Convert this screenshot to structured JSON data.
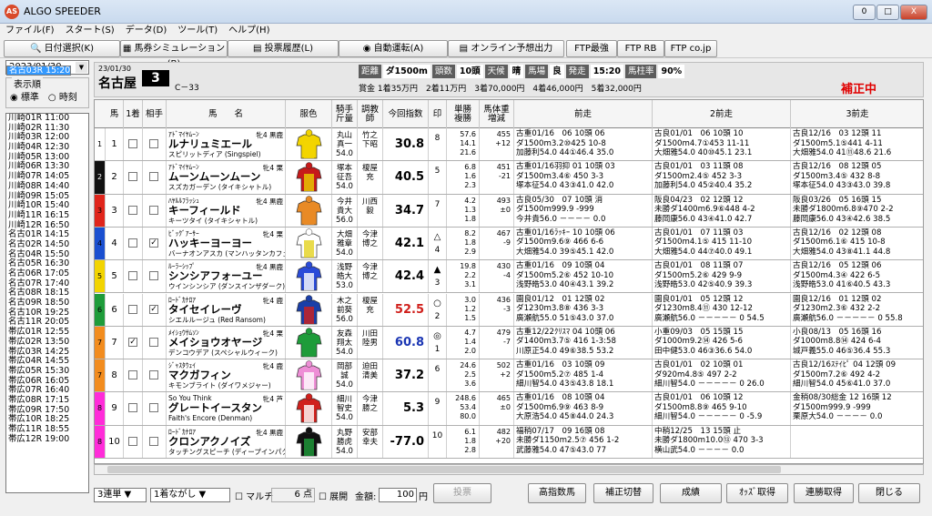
{
  "app": {
    "title": "ALGO SPEEDER",
    "logo": "AS",
    "min": "0",
    "max": "□",
    "close": "X"
  },
  "menu": [
    "ファイル(F)",
    "スタート(S)",
    "データ(D)",
    "ツール(T)",
    "ヘルプ(H)"
  ],
  "toolbar": {
    "date_select": "日付選択(K)",
    "baken_sim": "馬券シミュレーション(B)",
    "vote_history": "投票履歴(L)",
    "auto_vote": "自動運転(A)",
    "online": "オンライン予想出力",
    "ftp_best": "FTP最強",
    "ftp_rb": "FTP RB",
    "ftp_cojp": "FTP co.jp"
  },
  "left": {
    "date": "2023/01/30",
    "order_label": "表示順",
    "opt_std": "標準",
    "opt_time": "時刻",
    "races": [
      "川崎01R 11:00",
      "川崎02R 11:30",
      "川崎03R 12:00",
      "川崎04R 12:30",
      "川崎05R 13:00",
      "川崎06R 13:30",
      "川崎07R 14:05",
      "川崎08R 14:40",
      "川崎09R 15:05",
      "川崎10R 15:40",
      "川崎11R 16:15",
      "川崎12R 16:50",
      "名古01R 14:15",
      "名古02R 14:50",
      "名古03R 15:20",
      "名古04R 15:50",
      "名古05R 16:30",
      "名古06R 17:05",
      "名古07R 17:40",
      "名古08R 18:15",
      "名古09R 18:50",
      "名古10R 19:25",
      "名古11R 20:05",
      "帯広01R 12:55",
      "帯広02R 13:50",
      "帯広03R 14:25",
      "帯広04R 14:55",
      "帯広05R 15:30",
      "帯広06R 16:05",
      "帯広07R 16:40",
      "帯広08R 17:15",
      "帯広09R 17:50",
      "帯広10R 18:25",
      "帯広11R 18:55",
      "帯広12R 19:00"
    ],
    "selected": 14
  },
  "race": {
    "date": "23/01/30",
    "venue": "名古屋",
    "number": "3",
    "class": "C－33",
    "info": [
      [
        "距離",
        "ダ1500m"
      ],
      [
        "頭数",
        "10頭"
      ],
      [
        "天候",
        "晴"
      ],
      [
        "馬場",
        "良"
      ],
      [
        "発走",
        "15:20"
      ],
      [
        "馬柱率",
        "90%"
      ]
    ],
    "prize": "賞金 1着35万円　2着11万円　3着70,000円　4着46,000円　5着32,000円",
    "hosei": "補正中"
  },
  "headers": [
    "馬",
    "1着",
    "相手",
    "馬　　名",
    "服色",
    "騎手\n斤量",
    "調教\n師",
    "今回指数",
    "印",
    "単勝\n複勝",
    "馬体重\n増減",
    "前走",
    "2前走",
    "3前走"
  ],
  "horses": [
    {
      "frame": "1",
      "fc": "#ffffff",
      "n": "1",
      "c1": false,
      "c2": false,
      "sire": "ｱﾄﾞﾏｲﾔﾑｰﾝ",
      "name": "ルナリュミエール",
      "dam": "スピリットディア (Singspiel)",
      "sx": "牝4 黒鹿",
      "jky": "丸山\n真一\n54.0",
      "trn": "竹之\n下昭",
      "idx": "30.8",
      "icolor": "#000",
      "m1": "",
      "m2": "8",
      "o1": "57.6",
      "o2": "14.1",
      "o3": "21.6",
      "w1": "455",
      "w2": "+12",
      "silk": [
        "#f2d400",
        "#f2d400"
      ],
      "r1": [
        "古重01/16　06 10頭 06",
        "ダ1500m3.2⑩425 10-8",
        "加藤利54.0 44①46.4 35.0"
      ],
      "r2": [
        "古良01/01　06 10頭 10",
        "ダ1500m4.7①453 11-11",
        "大畑雅54.0 40⑩45.1 23.1"
      ],
      "r3": [
        "古良12/16　03 12頭 11",
        "ダ1500m5.1⑤441 4-11",
        "大畑雅54.0 41⑪48.6 21.6"
      ]
    },
    {
      "frame": "2",
      "fc": "#111111",
      "n": "2",
      "c1": false,
      "c2": false,
      "sire": "ｱﾄﾞﾏｲﾔﾑｰﾝ",
      "name": "ムーンムーンムーン",
      "dam": "スズカガーデン (タイキシャトル)",
      "sx": "牝4 栗",
      "jky": "塚本\n征吾\n54.0",
      "trn": "榎屋\n充",
      "idx": "40.5",
      "icolor": "#000",
      "m1": "",
      "m2": "5",
      "o1": "6.8",
      "o2": "1.6",
      "o3": "2.3",
      "w1": "451",
      "w2": "-21",
      "silk": [
        "#c61a1a",
        "#e8d000"
      ],
      "r1": [
        "古重01/16羽抑 01 10頭 03",
        "ダ1500m3.4⑥ 450 3-3",
        "塚本征54.0 43③41.0 42.0"
      ],
      "r2": [
        "古良01/01　03 11頭 08",
        "ダ1500m2.4⑤ 452 3-3",
        "加藤利54.0 45②40.4 35.2"
      ],
      "r3": [
        "古良12/16　08 12頭 05",
        "ダ1500m3.4⑤ 432 8-8",
        "塚本征54.0 43③43.0 39.8"
      ]
    },
    {
      "frame": "3",
      "fc": "#e0251b",
      "n": "3",
      "c1": false,
      "c2": false,
      "sire": "ﾊﾔﾙﾙﾌﾗｯｼｭ",
      "name": "キーフィールド",
      "dam": "キーツタイ (タイキシャトル)",
      "sx": "牝4 黒鹿",
      "jky": "今井\n貴大\n56.0",
      "trn": "川西\n毅",
      "idx": "34.7",
      "icolor": "#000",
      "m1": "",
      "m2": "7",
      "o1": "4.2",
      "o2": "1.3",
      "o3": "1.8",
      "w1": "493",
      "w2": "±0",
      "silk": [
        "#e88a26",
        "#e88a26"
      ],
      "r1": [
        "古良05/30　07 10頭 消",
        "ダ1500m999.9 -999",
        "今井貴56.0 －－－－ 0.0"
      ],
      "r2": [
        "阪良04/23　02 12頭 12",
        "未勝ダ1400m6.9⑥448 4-2",
        "藤岡康56.0 43④41.0 42.7"
      ],
      "r3": [
        "阪良03/26　05 16頭 15",
        "未勝ダ1800m6.8⑨470 2-2",
        "藤岡康56.0 43④42.6 38.5"
      ]
    },
    {
      "frame": "4",
      "fc": "#1a4fd0",
      "n": "4",
      "c1": false,
      "c2": true,
      "sire": "ﾋﾞｯｸﾞｱｰｻｰ",
      "name": "ハッキーヨーヨー",
      "dam": "バーナオンアスカ (マンハッタンカフェ)",
      "sx": "牝4 栗",
      "jky": "大畑\n雅章\n54.0",
      "trn": "今津\n博之",
      "idx": "42.1",
      "icolor": "#000",
      "m1": "△",
      "m2": "4",
      "o1": "8.2",
      "o2": "1.8",
      "o3": "2.9",
      "w1": "467",
      "w2": "-9",
      "silk": [
        "#ffffff",
        "#e3d21e"
      ],
      "r1": [
        "古重01/16ﾗｯｷｰ 10 10頭 06",
        "ダ1500m9.6⑨ 466 6-6",
        "大畑雅54.0 39⑤45.1 42.0"
      ],
      "r2": [
        "古良01/01　07 11頭 03",
        "ダ1500m4.1⑤ 415 11-10",
        "大畑雅54.0 44⑦40.0 49.1"
      ],
      "r3": [
        "古良12/16　02 12頭 08",
        "ダ1500m6.1⑥ 415 10-8",
        "大畑雅54.0 43⑧41.1 44.8"
      ]
    },
    {
      "frame": "5",
      "fc": "#f2d400",
      "n": "5",
      "c1": false,
      "c2": false,
      "sire": "ﾙｰﾗｰｼｯﾌﾟ",
      "name": "シンシアフォーユー",
      "dam": "ウインシンシア (ダンスインザダーク)",
      "sx": "牝4 黒鹿",
      "jky": "浅野\n皓大\n53.0",
      "trn": "今津\n博之",
      "idx": "42.4",
      "icolor": "#000",
      "m1": "▲",
      "m2": "3",
      "o1": "19.8",
      "o2": "2.2",
      "o3": "3.1",
      "w1": "430",
      "w2": "-4",
      "silk": [
        "#2a4bd8",
        "#ffffff"
      ],
      "r1": [
        "古重01/16　09 10頭 04",
        "ダ1500m5.2⑥ 452 10-10",
        "浅野皓53.0 40④43.1 39.2"
      ],
      "r2": [
        "古良01/01　08 11頭 07",
        "ダ1500m5.2⑥ 429 9-9",
        "浅野皓53.0 42⑤40.9 39.3"
      ],
      "r3": [
        "古良12/16　05 12頭 06",
        "ダ1500m4.3④ 422 6-5",
        "浅野皓53.0 41⑥40.5 43.3"
      ]
    },
    {
      "frame": "6",
      "fc": "#1e9c3a",
      "n": "6",
      "c1": false,
      "c2": true,
      "sire": "ﾛｰﾄﾞｶﾅﾛｱ",
      "name": "タイセイレーヴ",
      "dam": "シエルルージュ (Red Ransom)",
      "sx": "牝4 鹿",
      "jky": "木之\n前葵\n56.0",
      "trn": "榎屋\n充",
      "idx": "52.5",
      "icolor": "#d0201c",
      "m1": "○",
      "m2": "2",
      "o1": "3.0",
      "o2": "1.2",
      "o3": "1.5",
      "w1": "436",
      "w2": "-3",
      "silk": [
        "#1a3fa8",
        "#d0201c"
      ],
      "r1": [
        "園良01/12　01 12頭 02",
        "ダ1230m3.8⑧ 436 3-3",
        "廣瀬航55.0 51⑤43.0 37.0"
      ],
      "r2": [
        "園良01/01　05 12頭 12",
        "ダ1230m8.4⑪ 430 12-12",
        "廣瀬航56.0 －－－－－ 0 54.5"
      ],
      "r3": [
        "園良12/16　01 12頭 02",
        "ダ1230m2.3⑥ 432 2-2",
        "廣瀬航56.0 －－－－－ 0 55.8"
      ]
    },
    {
      "frame": "7",
      "fc": "#f28c1e",
      "n": "7",
      "c1": true,
      "c2": false,
      "sire": "ﾒｲｼｮｳｻﾑｿﾝ",
      "name": "メイショウオヤージ",
      "dam": "デンコウデア (スペシャルウィーク)",
      "sx": "牝4 栗",
      "jky": "友森\n翔太\n54.0",
      "trn": "川田\n陸男",
      "idx": "60.8",
      "icolor": "#1a35b3",
      "m1": "◎",
      "m2": "1",
      "o1": "4.7",
      "o2": "1.4",
      "o3": "2.0",
      "w1": "479",
      "w2": "-7",
      "silk": [
        "#1e9c3a",
        "#1e9c3a"
      ],
      "r1": [
        "古重12/22ｸﾘｽﾏ 04 10頭 06",
        "ダ1400m3.7⑤ 416 1-3:58",
        "川原正54.0 49⑥38.5 53.2"
      ],
      "r2": [
        "小重09/03　05 15頭 15",
        "ダ1000m9.2⑭ 426 5-6",
        "田中健53.0 46③36.6 54.0"
      ],
      "r3": [
        "小良08/13　05 16頭 16",
        "ダ1000m8.8⑭ 424 6-4",
        "城戸義55.0 46⑤36.4 55.3"
      ]
    },
    {
      "frame": "7",
      "fc": "#f28c1e",
      "n": "8",
      "c1": false,
      "c2": false,
      "sire": "ｼﾞｬｽﾀｳｪｲ",
      "name": "マクガフィン",
      "dam": "キモンブライト (ダイワメジャー)",
      "sx": "牝4 鹿",
      "jky": "岡部\n誠\n54.0",
      "trn": "迫田\n清美",
      "idx": "37.2",
      "icolor": "#000",
      "m1": "",
      "m2": "6",
      "o1": "24.6",
      "o2": "2.5",
      "o3": "3.6",
      "w1": "502",
      "w2": "+2",
      "silk": [
        "#ee8ed6",
        "#ffffff"
      ],
      "r1": [
        "古重01/16　03 10頭 09",
        "ダ1500m5.2⑦ 485 1-4",
        "細川智54.0 43⑤43.8 18.1"
      ],
      "r2": [
        "古良01/01　02 10頭 01",
        "ダ920m4.8⑤ 497 2-2",
        "細川智54.0 －－－－－ 0 26.0"
      ],
      "r3": [
        "古良12/16ｽﾃｲﾋﾟ 04 12頭 09",
        "ダ1500m7.2⑥ 492 4-2",
        "細川智54.0 45⑥41.0 37.0"
      ]
    },
    {
      "frame": "8",
      "fc": "#ff2cd9",
      "n": "9",
      "c1": false,
      "c2": false,
      "sire": "So You Think",
      "name": "グレートイースタン",
      "dam": "Faith's Encore (Denman)",
      "sx": "牝4 芦",
      "jky": "細川\n智史\n54.0",
      "trn": "今津\n勝之",
      "idx": "5.3",
      "icolor": "#000",
      "m1": "",
      "m2": "9",
      "o1": "248.6",
      "o2": "53.4",
      "o3": "80.0",
      "w1": "465",
      "w2": "±0",
      "silk": [
        "#d0201c",
        "#ffffff"
      ],
      "r1": [
        "古重01/16　08 10頭 04",
        "ダ1500m6.9⑨ 463 8-9",
        "大原浩54.0 45⑧44.0 24.3"
      ],
      "r2": [
        "古良01/01　06 10頭 12",
        "ダ1500m8.8⑨ 465 9-10",
        "細川智54.0 －－－－－ 0 -5.9"
      ],
      "r3": [
        "金稍08/30総金 12 16頭 12",
        "ダ1500m999.9 -999",
        "栗原大54.0 －－－－ 0.0"
      ]
    },
    {
      "frame": "8",
      "fc": "#ff2cd9",
      "n": "10",
      "c1": false,
      "c2": false,
      "sire": "ﾛｰﾄﾞｶﾅﾛｱ",
      "name": "クロンアクノイズ",
      "dam": "タッチングスピーチ (ディープインパクト)",
      "sx": "牝4 黒鹿",
      "jky": "丸野\n勝虎\n54.0",
      "trn": "安部\n幸夫",
      "idx": "-77.0",
      "icolor": "#000",
      "m1": "",
      "m2": "10",
      "o1": "6.1",
      "o2": "1.8",
      "o3": "2.8",
      "w1": "482",
      "w2": "+20",
      "silk": [
        "#111111",
        "#1e9c3a"
      ],
      "r1": [
        "福稍07/17　09 16頭 08",
        "未勝ダ1150m2.5⑦ 456 1-2",
        "武藤雅54.0 47⑤43.0 77"
      ],
      "r2": [
        "中稍12/25　13 15頭 止",
        "未勝ダ1800m10.0⑬ 470 3-3",
        "横山武54.0 －－－－ 0.0"
      ],
      "r3": [
        "",
        "",
        ""
      ]
    }
  ],
  "bottom": {
    "bet_type": "3連単",
    "bet_mode": "1着ながし",
    "multi": "マルチ",
    "points": "6 点",
    "expand": "展開",
    "amount_label": "金額:",
    "amount": "100",
    "yen": "円",
    "vote": "投票",
    "b1": "高指数馬",
    "b2": "補正切替",
    "b3": "成績",
    "b4": "ｵｯｽﾞ取得",
    "b5": "連勝取得",
    "b6": "閉じる"
  }
}
